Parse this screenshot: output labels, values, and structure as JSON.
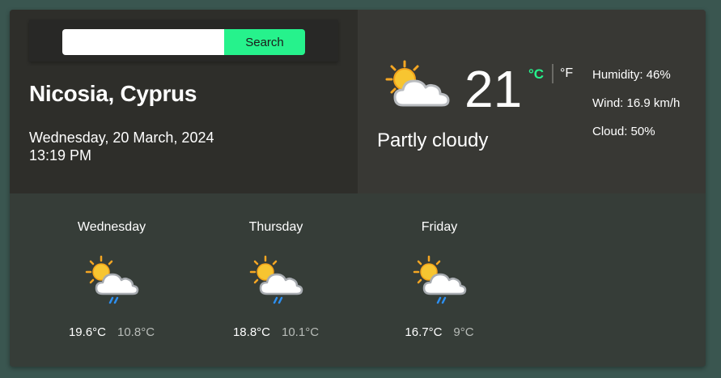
{
  "search": {
    "placeholder": "",
    "value": "",
    "button_label": "Search"
  },
  "location": {
    "city": "Nicosia, Cyprus",
    "date": "Wednesday, 20 March, 2024",
    "time": "13:19 PM"
  },
  "current": {
    "temperature": "21",
    "unit_c": "°C",
    "unit_f": "°F",
    "active_unit": "C",
    "condition": "Partly cloudy",
    "icon": "partly-cloudy-icon",
    "humidity": "Humidity: 46%",
    "wind": "Wind: 16.9 km/h",
    "cloud": "Cloud: 50%"
  },
  "forecast": [
    {
      "day": "Wednesday",
      "max": "19.6°C",
      "min": "10.8°C",
      "icon": "partly-cloudy-rain-icon"
    },
    {
      "day": "Thursday",
      "max": "18.8°C",
      "min": "10.1°C",
      "icon": "partly-cloudy-rain-icon"
    },
    {
      "day": "Friday",
      "max": "16.7°C",
      "min": "9°C",
      "icon": "partly-cloudy-rain-icon"
    }
  ],
  "colors": {
    "accent": "#26f28c",
    "page_bg": "#3a5650",
    "panel_left": "#2e2e2a",
    "panel_right": "#383834",
    "panel_bottom": "#363d38"
  }
}
